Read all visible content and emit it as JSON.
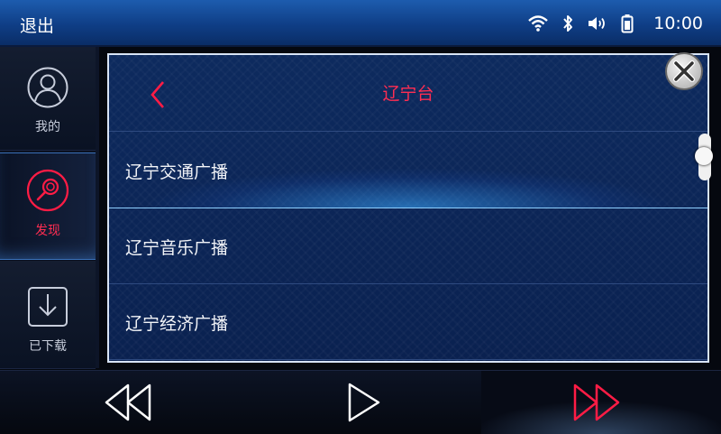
{
  "status_bar": {
    "back_label": "退出",
    "icons": [
      "wifi-icon",
      "bluetooth-icon",
      "volume-icon",
      "battery-icon"
    ],
    "time": "10:00"
  },
  "sidebar": {
    "items": [
      {
        "label": "我的",
        "icon": "user-icon",
        "active": false
      },
      {
        "label": "发现",
        "icon": "discover-icon",
        "active": true
      },
      {
        "label": "已下载",
        "icon": "download-icon",
        "active": false
      }
    ]
  },
  "panel": {
    "title": "辽宁台",
    "items": [
      {
        "label": "辽宁交通广播",
        "selected": true
      },
      {
        "label": "辽宁音乐广播",
        "selected": false
      },
      {
        "label": "辽宁经济广播",
        "selected": false
      }
    ]
  },
  "playback": {
    "buttons": [
      "previous-icon",
      "play-icon",
      "next-icon"
    ]
  },
  "colors": {
    "accent": "#ff1c45",
    "header_blue": "#1d5cae",
    "panel_blue": "#0d2a5e"
  }
}
